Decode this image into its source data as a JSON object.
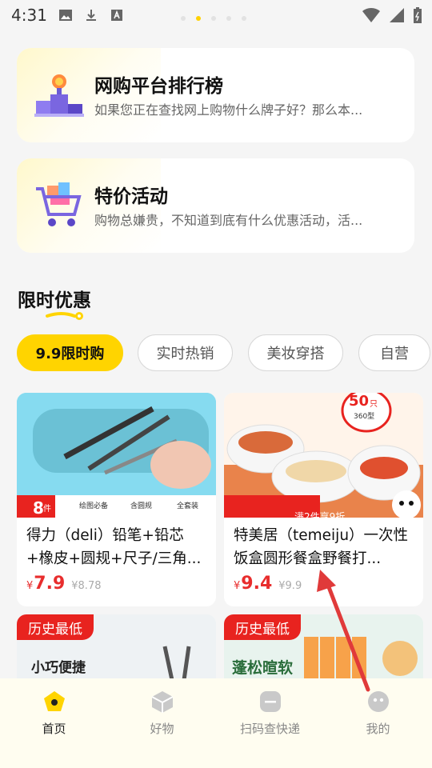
{
  "status_bar": {
    "time": "4:31"
  },
  "features": [
    {
      "title": "网购平台排行榜",
      "desc": "如果您正在查找网上购物什么牌子好？那么本..."
    },
    {
      "title": "特价活动",
      "desc": "购物总嫌贵，不知道到底有什么优惠活动，活..."
    }
  ],
  "section": {
    "title": "限时优惠"
  },
  "chips": [
    "9.9限时购",
    "实时热销",
    "美妆穿搭",
    "自营"
  ],
  "products": [
    {
      "name": "得力（deli）铅笔+铅芯+橡皮+圆规+尺子/三角...",
      "currency": "¥",
      "price": "7.9",
      "orig_price": "¥8.78"
    },
    {
      "name": "特美居（temeiju）一次性饭盒圆形餐盒野餐打...",
      "currency": "¥",
      "price": "9.4",
      "orig_price": "¥9.9"
    },
    {
      "badge": "历史最低",
      "img_text": "小巧便捷"
    },
    {
      "badge": "历史最低",
      "img_text": "蓬松暄软"
    }
  ],
  "product_img_labels": {
    "p1_count": "8",
    "p1_unit": "件",
    "p1_tags": [
      "绘图必备",
      "含圆规",
      "全套装"
    ],
    "p2_badge_num": "50",
    "p2_badge_unit": "只",
    "p2_badge_sub": "360型",
    "p2_tag": "满2件享9折"
  },
  "bottom_nav": [
    {
      "label": "首页",
      "icon": "home-icon",
      "active": true
    },
    {
      "label": "好物",
      "icon": "cube-icon",
      "active": false
    },
    {
      "label": "扫码查快递",
      "icon": "scan-icon",
      "active": false
    },
    {
      "label": "我的",
      "icon": "profile-icon",
      "active": false
    }
  ],
  "colors": {
    "accent": "#ffd400",
    "price": "#e82d2d",
    "badge": "#e8231f",
    "annotation_arrow": "#e03a3a"
  }
}
